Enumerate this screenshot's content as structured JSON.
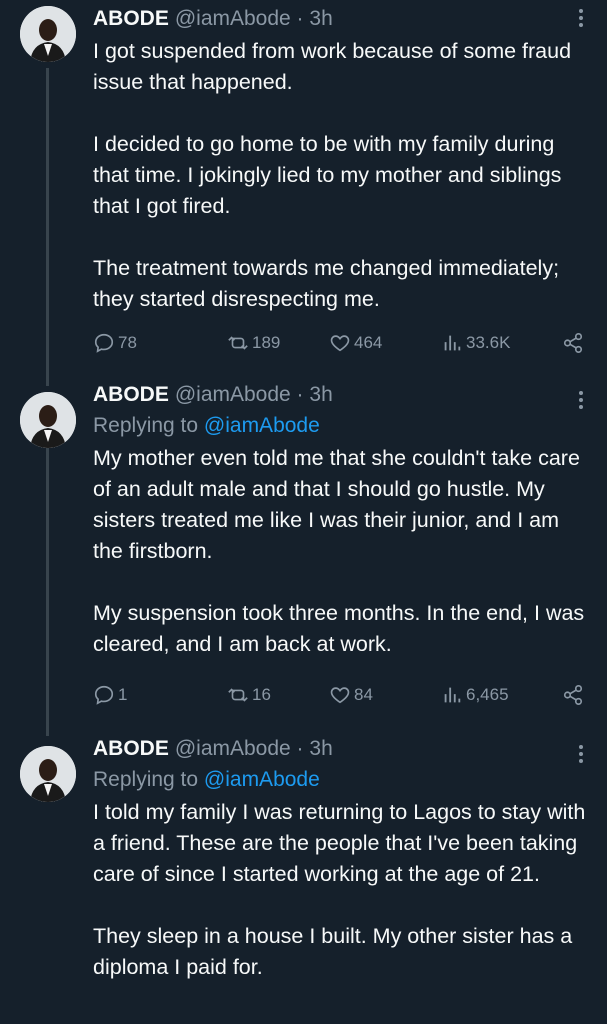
{
  "tweets": [
    {
      "name": "ABODE",
      "handle": "@iamAbode · 3h",
      "replying_label": "",
      "replying_to": "",
      "paragraphs": [
        "I got suspended from work because of some fraud issue that happened.",
        "I decided to go home to be with my family during that time. I jokingly lied to my mother and siblings that I got fired.",
        "The treatment towards me changed immediately; they started disrespecting me."
      ],
      "replies": "78",
      "retweets": "189",
      "likes": "464",
      "views": "33.6K"
    },
    {
      "name": "ABODE",
      "handle": "@iamAbode · 3h",
      "replying_label": "Replying to",
      "replying_to": "@iamAbode",
      "paragraphs": [
        "My mother even told me that she couldn't take care of an adult male and that I should go hustle. My sisters treated me like I was their junior, and I am the firstborn.",
        "My suspension took three months. In the end, I was cleared, and I am back at work."
      ],
      "replies": "1",
      "retweets": "16",
      "likes": "84",
      "views": "6,465"
    },
    {
      "name": "ABODE",
      "handle": "@iamAbode · 3h",
      "replying_label": "Replying to",
      "replying_to": "@iamAbode",
      "paragraphs": [
        "I told my family I was returning to Lagos to stay with a friend. These are the people that I've been taking care of since I started working at the age of 21.",
        "They sleep in a house I built. My other sister has a diploma I paid for."
      ]
    }
  ],
  "icons": {
    "reply": "reply-icon",
    "retweet": "retweet-icon",
    "like": "heart-icon",
    "views": "views-icon",
    "share": "share-icon",
    "more": "more-icon"
  },
  "colors": {
    "background": "#15202b",
    "text": "#f7f9f9",
    "muted": "#8b98a5",
    "link": "#1d9bf0",
    "thread_line": "#38444d"
  }
}
